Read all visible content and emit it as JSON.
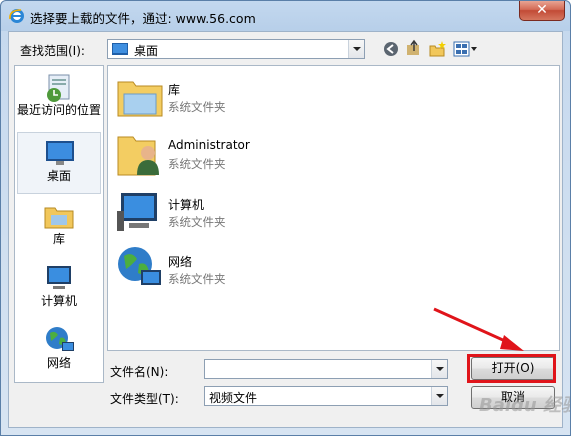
{
  "window": {
    "title": "选择要上载的文件，通过: www.56.com",
    "close_glyph": "✕"
  },
  "toolbar": {
    "look_in_label": "查找范围(I):",
    "look_in_value": "桌面"
  },
  "places": [
    {
      "label": "最近访问的位置"
    },
    {
      "label": "桌面"
    },
    {
      "label": "库"
    },
    {
      "label": "计算机"
    },
    {
      "label": "网络"
    }
  ],
  "files": [
    {
      "name": "库",
      "type": "系统文件夹"
    },
    {
      "name": "Administrator",
      "type": "系统文件夹"
    },
    {
      "name": "计算机",
      "type": "系统文件夹"
    },
    {
      "name": "网络",
      "type": "系统文件夹"
    }
  ],
  "filename": {
    "label": "文件名(N):",
    "value": ""
  },
  "filetype": {
    "label": "文件类型(T):",
    "value": "视频文件"
  },
  "buttons": {
    "open": "打开(O)",
    "cancel": "取消"
  },
  "watermark": "Baidu 经验",
  "colors": {
    "highlight": "#e0141a",
    "title_bar": "#b7cfe9"
  }
}
